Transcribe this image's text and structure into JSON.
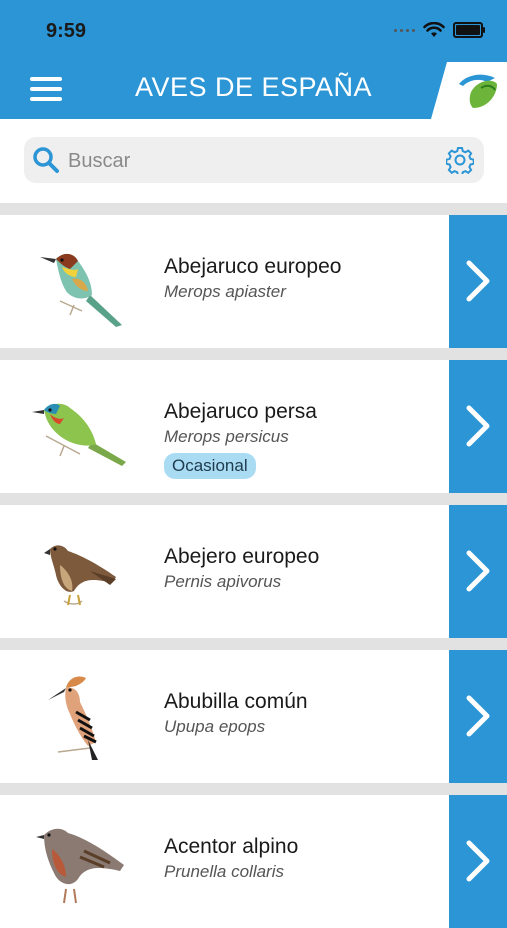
{
  "status_bar": {
    "time": "9:59"
  },
  "header": {
    "title": "AVES DE ESPAÑA"
  },
  "search": {
    "placeholder": "Buscar"
  },
  "colors": {
    "accent": "#2b95d6",
    "badge": "#a9dbf3",
    "separator": "#e2e2e2"
  },
  "birds": [
    {
      "common": "Abejaruco europeo",
      "scientific": "Merops apiaster",
      "badge": ""
    },
    {
      "common": "Abejaruco persa",
      "scientific": "Merops persicus",
      "badge": "Ocasional"
    },
    {
      "common": "Abejero europeo",
      "scientific": "Pernis apivorus",
      "badge": ""
    },
    {
      "common": "Abubilla común",
      "scientific": "Upupa epops",
      "badge": ""
    },
    {
      "common": "Acentor alpino",
      "scientific": "Prunella collaris",
      "badge": ""
    }
  ]
}
